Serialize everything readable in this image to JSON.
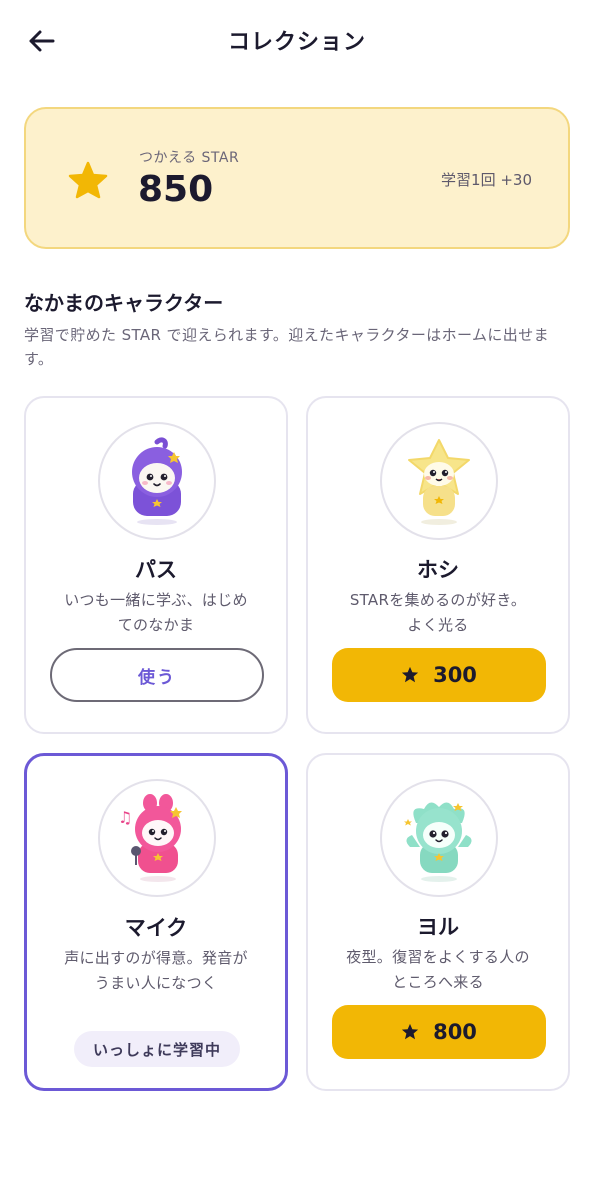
{
  "header": {
    "title": "コレクション",
    "back_icon": "arrow-left-icon"
  },
  "star_balance": {
    "label": "つかえる STAR",
    "value": "850",
    "bonus": "学習1回 +30",
    "icon": "star-icon",
    "accent_color": "#f2b705"
  },
  "section": {
    "title": "なかまのキャラクター",
    "description": "学習で貯めた STAR で迎えられます。迎えたキャラクターはホームに出せます。"
  },
  "characters": [
    {
      "name": "パス",
      "desc_line1": "いつも一緒に学ぶ、はじめ",
      "desc_line2": "てのなかま",
      "action": "使う",
      "state": "owned",
      "color": "#8a5fe0"
    },
    {
      "name": "ホシ",
      "desc_line1": "STARを集めるのが好き。",
      "desc_line2": "よく光る",
      "price": "300",
      "state": "locked",
      "color": "#f5e28a"
    },
    {
      "name": "マイク",
      "desc_line1": "声に出すのが得意。発音が",
      "desc_line2": "うまい人になつく",
      "badge": "いっしょに学習中",
      "state": "active",
      "color": "#f2579a"
    },
    {
      "name": "ヨル",
      "desc_line1": "夜型。復習をよくする人の",
      "desc_line2": "ところへ来る",
      "price": "800",
      "state": "locked",
      "color": "#8fe0c8"
    }
  ]
}
